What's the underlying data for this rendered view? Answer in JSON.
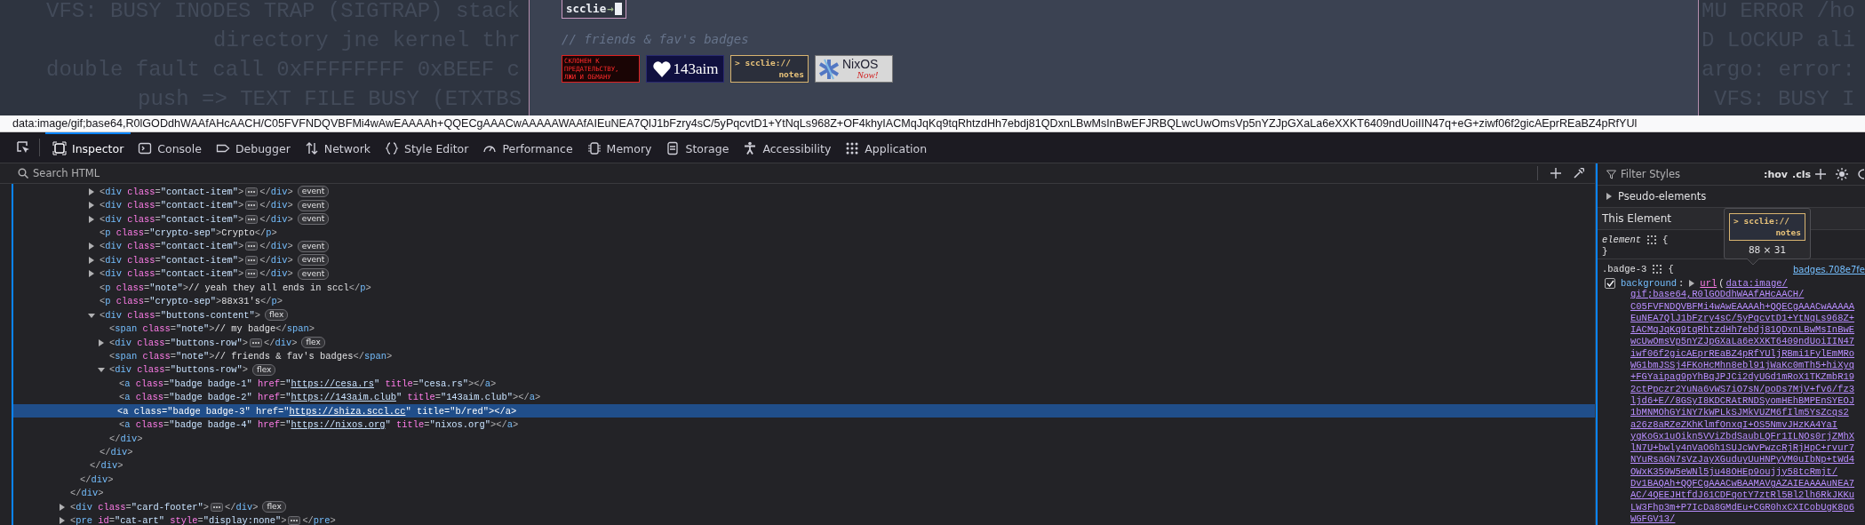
{
  "page": {
    "background_lines_left": [
      "VFS: BUSY INODES TRAP (SIGTRAP) stack",
      "directory jne kernel thr",
      "double fault call 0xFFFFFFFF 0xBEEF c",
      "push => TEXT FILE BUSY (ETXTBS"
    ],
    "card": {
      "command": {
        "value": "scclie",
        "arrow": "→"
      },
      "note": "// friends & fav's badges",
      "badges": [
        {
          "kind": "warning",
          "lines": [
            "СКЛОНЕН К",
            "ПРЕДАТЕЛЬСТВУ,",
            "ЛЖИ И ОБМАНУ"
          ]
        },
        {
          "kind": "heart",
          "lines": [
            "143aim"
          ]
        },
        {
          "kind": "terminal",
          "lines": [
            "> scclie://",
            "notes"
          ]
        },
        {
          "kind": "nixos",
          "lines": [
            "NixOS",
            "Now!"
          ]
        }
      ]
    },
    "background_lines_right": [
      "MU ERROR /ho",
      "D LOCKUP ali",
      "argo: error:",
      "VFS: BUSY I"
    ]
  },
  "link_preview": "data:image/gif;base64,R0lGODdhWAAfAHcAACH/C05FVFNDQVBFMi4wAwEAAAAh+QQECgAAACwAAAAAWAAfAIEuNEA7QlJ1bFzry4sC/5yPqcvtD1+YtNqLs968Z+OF4khyIACMqJqKq9tqRhtzdHh7ebdj81QDxnLBwMsInBwEFJRBQLwcUwOmsVp5nYZJpGXaLa6eXXKT6409ndUoiIIN47q+eG+ziwf06f2gicAEprREaBZ4pRfYUl",
  "toolbar": {
    "tabs": [
      {
        "label": "Inspector",
        "selected": true
      },
      {
        "label": "Console",
        "selected": false
      },
      {
        "label": "Debugger",
        "selected": false
      },
      {
        "label": "Network",
        "selected": false
      },
      {
        "label": "Style Editor",
        "selected": false
      },
      {
        "label": "Performance",
        "selected": false
      },
      {
        "label": "Memory",
        "selected": false
      },
      {
        "label": "Storage",
        "selected": false
      },
      {
        "label": "Accessibility",
        "selected": false
      },
      {
        "label": "Application",
        "selected": false
      }
    ]
  },
  "html_panel": {
    "search": {
      "placeholder": "Search HTML"
    },
    "syntax": {
      "open": "<",
      "close_open": "</",
      "end": ">",
      "eq": "=",
      "quote": "\""
    },
    "tree": [
      {
        "closing_tag": "div",
        "children": [
          {
            "closing_tag": "div",
            "children": [
              {
                "closing_tag": "div",
                "children": [
                  {
                    "tag": "div",
                    "attrs": [
                      {
                        "name": "class",
                        "value": "contact-item"
                      }
                    ],
                    "expanded": false,
                    "closing_tag": "div",
                    "badge": "event",
                    "selected": false
                  },
                  {
                    "tag": "div",
                    "attrs": [
                      {
                        "name": "class",
                        "value": "contact-item"
                      }
                    ],
                    "expanded": false,
                    "closing_tag": "div",
                    "badge": "event",
                    "selected": false
                  },
                  {
                    "tag": "div",
                    "attrs": [
                      {
                        "name": "class",
                        "value": "contact-item"
                      }
                    ],
                    "expanded": false,
                    "closing_tag": "div",
                    "badge": "event",
                    "selected": false
                  },
                  {
                    "tag": "p",
                    "attrs": [
                      {
                        "name": "class",
                        "value": "crypto-sep"
                      }
                    ],
                    "text": "Crypto",
                    "closing_tag": "p",
                    "selected": false
                  },
                  {
                    "tag": "div",
                    "attrs": [
                      {
                        "name": "class",
                        "value": "contact-item"
                      }
                    ],
                    "expanded": false,
                    "closing_tag": "div",
                    "badge": "event",
                    "selected": false
                  },
                  {
                    "tag": "div",
                    "attrs": [
                      {
                        "name": "class",
                        "value": "contact-item"
                      }
                    ],
                    "expanded": false,
                    "closing_tag": "div",
                    "badge": "event",
                    "selected": false
                  },
                  {
                    "tag": "div",
                    "attrs": [
                      {
                        "name": "class",
                        "value": "contact-item"
                      }
                    ],
                    "expanded": false,
                    "closing_tag": "div",
                    "badge": "event",
                    "selected": false
                  },
                  {
                    "tag": "p",
                    "attrs": [
                      {
                        "name": "class",
                        "value": "note"
                      }
                    ],
                    "text": "// yeah they all ends in sccl",
                    "closing_tag": "p",
                    "selected": false
                  },
                  {
                    "tag": "p",
                    "attrs": [
                      {
                        "name": "class",
                        "value": "crypto-sep"
                      }
                    ],
                    "text": "88x31's",
                    "closing_tag": "p",
                    "selected": false
                  },
                  {
                    "tag": "div",
                    "attrs": [
                      {
                        "name": "class",
                        "value": "buttons-content"
                      }
                    ],
                    "expanded": true,
                    "badge": "flex",
                    "selected": false,
                    "closing_tag": "div",
                    "children": [
                      {
                        "tag": "span",
                        "attrs": [
                          {
                            "name": "class",
                            "value": "note"
                          }
                        ],
                        "text": "// my badge",
                        "closing_tag": "span",
                        "selected": false
                      },
                      {
                        "tag": "div",
                        "attrs": [
                          {
                            "name": "class",
                            "value": "buttons-row"
                          }
                        ],
                        "expanded": false,
                        "closing_tag": "div",
                        "badge": "flex",
                        "selected": false
                      },
                      {
                        "tag": "span",
                        "attrs": [
                          {
                            "name": "class",
                            "value": "note"
                          }
                        ],
                        "text": "// friends & fav's badges",
                        "closing_tag": "span",
                        "selected": false
                      },
                      {
                        "tag": "div",
                        "attrs": [
                          {
                            "name": "class",
                            "value": "buttons-row"
                          }
                        ],
                        "expanded": true,
                        "badge": "flex",
                        "selected": false,
                        "closing_tag": "div",
                        "children": [
                          {
                            "tag": "a",
                            "attrs": [
                              {
                                "name": "class",
                                "value": "badge badge-1"
                              },
                              {
                                "name": "href",
                                "value": "https://cesa.rs",
                                "kind": "link"
                              },
                              {
                                "name": "title",
                                "value": "cesa.rs"
                              }
                            ],
                            "closing_tag": "a",
                            "selected": false
                          },
                          {
                            "tag": "a",
                            "attrs": [
                              {
                                "name": "class",
                                "value": "badge badge-2"
                              },
                              {
                                "name": "href",
                                "value": "https://143aim.club",
                                "kind": "link"
                              },
                              {
                                "name": "title",
                                "value": "143aim.club"
                              }
                            ],
                            "closing_tag": "a",
                            "selected": false
                          },
                          {
                            "tag": "a",
                            "attrs": [
                              {
                                "name": "class",
                                "value": "badge badge-3"
                              },
                              {
                                "name": "href",
                                "value": "https://shiza.sccl.cc",
                                "kind": "link"
                              },
                              {
                                "name": "title",
                                "value": "b/red"
                              }
                            ],
                            "closing_tag": "a",
                            "selected": true
                          },
                          {
                            "tag": "a",
                            "attrs": [
                              {
                                "name": "class",
                                "value": "badge badge-4"
                              },
                              {
                                "name": "href",
                                "value": "https://nixos.org",
                                "kind": "link"
                              },
                              {
                                "name": "title",
                                "value": "nixos.org"
                              }
                            ],
                            "closing_tag": "a",
                            "selected": false
                          }
                        ]
                      }
                    ]
                  }
                ]
              }
            ]
          }
        ]
      },
      {
        "tag": "div",
        "attrs": [
          {
            "name": "class",
            "value": "card-footer"
          }
        ],
        "expanded": false,
        "closing_tag": "div",
        "badge": "flex",
        "selected": false
      },
      {
        "tag": "pre",
        "attrs": [
          {
            "name": "id",
            "value": "cat-art"
          },
          {
            "name": "style",
            "value": "display:none"
          }
        ],
        "expanded": false,
        "closing_tag": "pre",
        "selected": false
      }
    ]
  },
  "styles_panel": {
    "filter": {
      "placeholder": "Filter Styles"
    },
    "hov": ":hov",
    "cls": ".cls",
    "pseudo_elements": {
      "label": "Pseudo-elements",
      "expanded": false
    },
    "section_title": "This Element",
    "rules": [
      {
        "selector": "element",
        "open_brace": "{",
        "close_brace": "}"
      },
      {
        "selector": ".badge-3",
        "open_brace": "{",
        "source": "badges.708e7fe",
        "declarations": [
          {
            "property": "background",
            "colon": ":",
            "enabled": true,
            "function": "url",
            "paren": "(",
            "value_lines": [
              "data:image/",
              "gif;base64,R0lGODdhWAAfAHcAACH/",
              "C05FVFNDQVBFMi4wAwEAAAAh+QQECgAAACwAAAAA",
              "EuNEA7QlJ1bFzry4sC/5yPqcvtD1+YtNqLs968Z+",
              "IACMqJqKq9tqRhtzdHh7ebdj81QDxnLBwMsInBwE",
              "wcUwOmsVp5nYZJpGXaLa6eXXKT6409ndUoiIIN47",
              "iwf06f2gicAEprREaBZ4pRfYUljRBmi1FylEmMRo",
              "WG1bmJSSj4FKoHcMhn8ebl91jWaKc0mTh5+hiXyq",
              "+FGYaipag9pYhBqJPJCi2dyUGd1mRoX1TKZmbR19",
              "2ctPpczr2YuNa6vWS7iO7sN/poDs7MjV+fv6/fz3",
              "ljd6+E//8GSyI8KDCRAtRNDSyomHEhBMPEnSYEOJ",
              "1bMNMOhGYiNY7kWPLkSJMkVUZM6fIlm5YsZcqs2",
              "a26z8aRZeZKhKlmfOnxqI+OS5NmvJHzKA4YaI",
              "ygKoGx1uOikn5VViZbdSaubLQFr1ILNOs0rjZMhX",
              "lN7U+bwly4nVaO6h1SUJcWvPwzcRjRjHpC+rvur7",
              "NYuRsaGN7sVzJayXGuduyUuHNPyVM0uIbNp+tWd4",
              "OWxK359W5eWNl5ju48OHEp9oujjy58tcRmjt/",
              "Dv1BAQAh+QQFCgAAACwBAAMAVgAZAIEAAAAuNEA7",
              "AC/4QEEJHtfdJ61CDFqotY7ztRl5Bl2lh6RkJKKu",
              "LW3Fhp3m+P7IcDa8GMdEu+CGR0hxCXICobUgK8p6",
              "WGFGV13/"
            ]
          }
        ]
      }
    ]
  },
  "tooltip": {
    "preview": {
      "kind": "terminal",
      "lines": [
        "> scclie://",
        "notes"
      ]
    },
    "size": "88 × 31"
  }
}
